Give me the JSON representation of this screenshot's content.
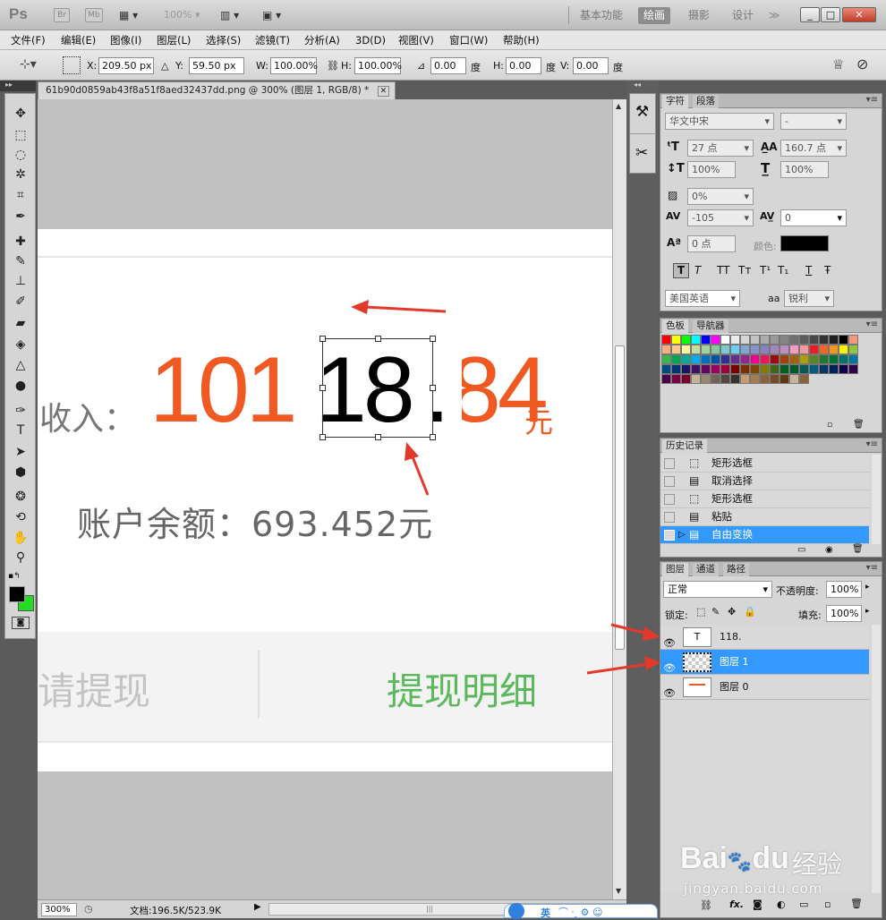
{
  "titlebar": {
    "logo": "Ps",
    "br": "Br",
    "mb": "Mb",
    "zoom": "100%",
    "workspaces": [
      "基本功能",
      "绘画",
      "摄影",
      "设计"
    ],
    "active_workspace": "绘画",
    "more": "≫",
    "win_min": "_",
    "win_max": "□",
    "win_close": "✕"
  },
  "menu": [
    "文件(F)",
    "编辑(E)",
    "图像(I)",
    "图层(L)",
    "选择(S)",
    "滤镜(T)",
    "分析(A)",
    "3D(D)",
    "视图(V)",
    "窗口(W)",
    "帮助(H)"
  ],
  "options": {
    "x_label": "X:",
    "x_value": "209.50 px",
    "y_label": "Y:",
    "y_value": "59.50 px",
    "w_label": "W:",
    "w_value": "100.00%",
    "h_label": "H:",
    "h_value": "100.00%",
    "angle_value": "0.00",
    "angle_unit": "度",
    "hskew_label": "H:",
    "hskew_value": "0.00",
    "hskew_unit": "度",
    "vskew_label": "V:",
    "vskew_value": "0.00",
    "vskew_unit": "度"
  },
  "document": {
    "tab_title": "61b90d0859ab43f8a51f8aed32437dd.png @ 300% (图层 1, RGB/8) *",
    "close": "✕",
    "income_label": "收入：",
    "amount_orange_left": "101",
    "amount_edit": "18",
    "amount_dot": ".",
    "amount_orange_right": "84",
    "yuan": "元",
    "balance": "账户余额：693.452元",
    "withdraw": "请提现",
    "withdraw_detail": "提现明细",
    "accent_orange": "#f05a22",
    "accent_green": "#5cb85c"
  },
  "status": {
    "zoom": "300%",
    "doc_size": "文档:196.5K/523.9K"
  },
  "character_panel": {
    "tab_char": "字符",
    "tab_para": "段落",
    "font_family": "华文中宋",
    "font_style": "-",
    "font_size": "27 点",
    "leading": "160.7 点",
    "v_scale": "100%",
    "h_scale": "100%",
    "tsume": "0%",
    "kerning": "-105",
    "tracking": "0",
    "baseline": "0 点",
    "color_label": "颜色:",
    "style_buttons": [
      "T",
      "T",
      "TT",
      "Tт",
      "T¹",
      "T₁",
      "T",
      "Ŧ"
    ],
    "language": "美国英语",
    "aa_label": "aa",
    "antialias": "锐利"
  },
  "swatches_panel": {
    "tab_swatches": "色板",
    "tab_navigator": "导航器",
    "colors": [
      "#ff0000",
      "#ffff00",
      "#00ff00",
      "#00ffff",
      "#0000ff",
      "#ff00ff",
      "#ffffff",
      "#ebebeb",
      "#d6d6d6",
      "#c2c2c2",
      "#adadad",
      "#999999",
      "#858585",
      "#707070",
      "#5c5c5c",
      "#474747",
      "#333333",
      "#1f1f1f",
      "#000000",
      "#f7977a",
      "#f9ad81",
      "#fdc68a",
      "#fff79a",
      "#c4df9b",
      "#a3d39c",
      "#82ca9d",
      "#7bcdc8",
      "#6ecff6",
      "#7ea7d8",
      "#8493ca",
      "#8882be",
      "#a187be",
      "#bc8dbf",
      "#f49ac2",
      "#f6989d",
      "#ed1c24",
      "#f26522",
      "#f7941d",
      "#fff200",
      "#8dc63f",
      "#39b54a",
      "#00a651",
      "#00a99d",
      "#00aeef",
      "#0072bc",
      "#0054a6",
      "#2e3192",
      "#662d91",
      "#92278f",
      "#ec008c",
      "#ed145b",
      "#9e0b0f",
      "#a0410d",
      "#a3620a",
      "#aba000",
      "#598527",
      "#1a7b30",
      "#007236",
      "#00746b",
      "#0076a3",
      "#004b80",
      "#003471",
      "#1b1464",
      "#440e62",
      "#630460",
      "#9e005d",
      "#9e0039",
      "#790000",
      "#7b2e00",
      "#7d4900",
      "#827b00",
      "#406618",
      "#005e20",
      "#005826",
      "#005952",
      "#005b7f",
      "#003663",
      "#002157",
      "#0d004c",
      "#32004b",
      "#4b0049",
      "#7b0046",
      "#7a0026",
      "#c7b299",
      "#998675",
      "#736357",
      "#534741",
      "#37302d",
      "#c69c6d",
      "#a67c52",
      "#8c6239",
      "#754c24",
      "#603913",
      "#c8b49b",
      "#8c6239"
    ]
  },
  "history_panel": {
    "tab": "历史记录",
    "items": [
      "矩形选框",
      "取消选择",
      "矩形选框",
      "粘贴",
      "自由变换"
    ],
    "selected_index": 4
  },
  "layers_panel": {
    "tabs": [
      "图层",
      "通道",
      "路径"
    ],
    "blend_mode": "正常",
    "opacity_label": "不透明度:",
    "opacity": "100%",
    "lock_label": "锁定:",
    "fill_label": "填充:",
    "fill": "100%",
    "layers": [
      {
        "name": "118.",
        "thumb": "T",
        "selected": false
      },
      {
        "name": "图层 1",
        "thumb": "",
        "selected": true
      },
      {
        "name": "图层 0",
        "thumb": "",
        "selected": false
      }
    ],
    "footer_icons": [
      "link-icon",
      "fx-icon",
      "mask-icon",
      "adjustment-icon",
      "group-icon",
      "new-layer-icon",
      "trash-icon"
    ],
    "fx_label": "fx."
  },
  "watermark": {
    "brand": "Bai",
    "brand2": "du",
    "cn": "经验",
    "url": "jingyan.baidu.com"
  },
  "ime": {
    "lang": "英"
  }
}
